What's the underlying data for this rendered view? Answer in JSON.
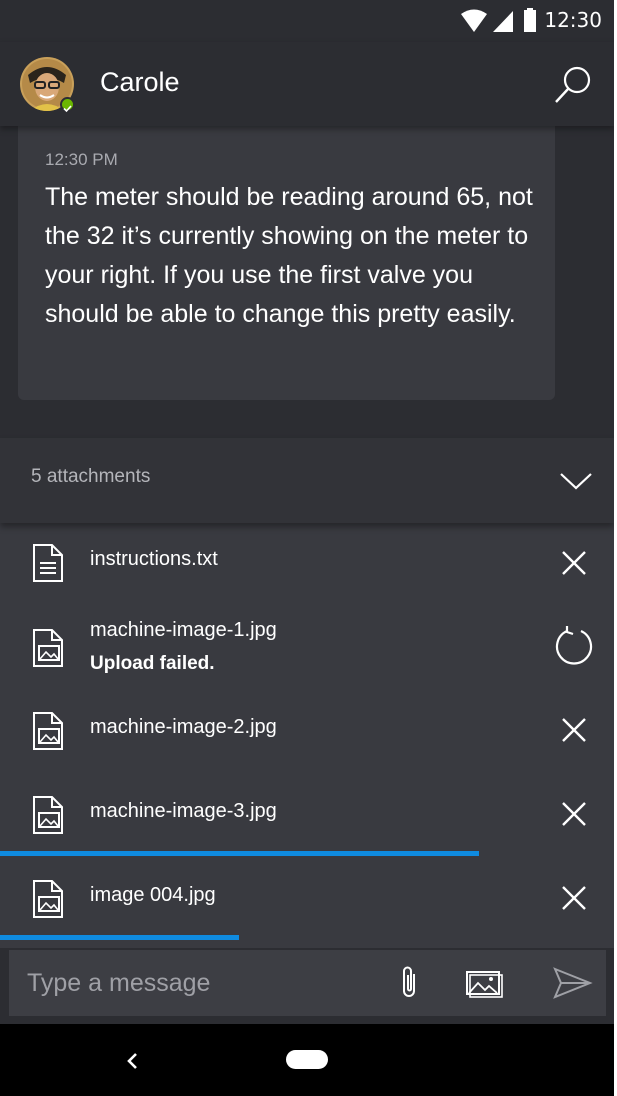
{
  "status_bar": {
    "time": "12:30",
    "icons": [
      "wifi-icon",
      "signal-icon",
      "battery-icon"
    ]
  },
  "header": {
    "contact_name": "Carole",
    "presence": "available",
    "search_icon": "search-icon"
  },
  "message": {
    "time": "12:30 PM",
    "text": "The meter should be reading around 65, not the 32 it’s currently showing on the meter to your right. If you use the first valve you should be able to change this pretty easily."
  },
  "attachments": {
    "count_label": "5 attachments",
    "toggle_icon": "chevron-down-icon",
    "items": [
      {
        "name": "instructions.txt",
        "type": "document",
        "status": "",
        "action": "close-icon",
        "progress": null
      },
      {
        "name": "machine-image-1.jpg",
        "type": "image",
        "status": "Upload failed.",
        "action": "retry-icon",
        "progress": null
      },
      {
        "name": "machine-image-2.jpg",
        "type": "image",
        "status": "",
        "action": "close-icon",
        "progress": null
      },
      {
        "name": "machine-image-3.jpg",
        "type": "image",
        "status": "",
        "action": "close-icon",
        "progress": 0.78
      },
      {
        "name": "image 004.jpg",
        "type": "image",
        "status": "",
        "action": "close-icon",
        "progress": 0.39
      }
    ]
  },
  "compose": {
    "placeholder": "Type a message",
    "value": "",
    "icons": [
      "paperclip-icon",
      "image-icon",
      "send-icon"
    ]
  },
  "nav_bar": {
    "icons": [
      "back-icon",
      "home-icon"
    ]
  },
  "colors": {
    "background": "#2c2d32",
    "surface": "#393a40",
    "accent": "#0f8be0",
    "presence": "#6bb700"
  }
}
